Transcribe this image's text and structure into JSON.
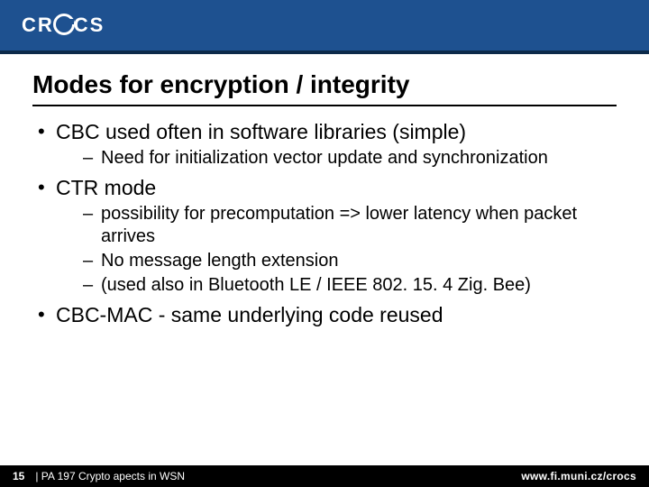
{
  "header": {
    "logo_text_pre": "CR",
    "logo_text_post": "CS"
  },
  "title": "Modes for encryption / integrity",
  "bullets": [
    {
      "text": "CBC used often in software libraries (simple)",
      "sub": [
        "Need for initialization vector update and synchronization"
      ]
    },
    {
      "text": "CTR mode",
      "sub": [
        "possibility for precomputation => lower latency when packet arrives",
        "No message length extension",
        "(used also in Bluetooth LE / IEEE 802. 15. 4 Zig. Bee)"
      ]
    },
    {
      "text": "CBC-MAC - same underlying code reused",
      "sub": []
    }
  ],
  "footer": {
    "page": "15",
    "course": "| PA 197 Crypto apects in WSN",
    "url": "www.fi.muni.cz/crocs"
  }
}
